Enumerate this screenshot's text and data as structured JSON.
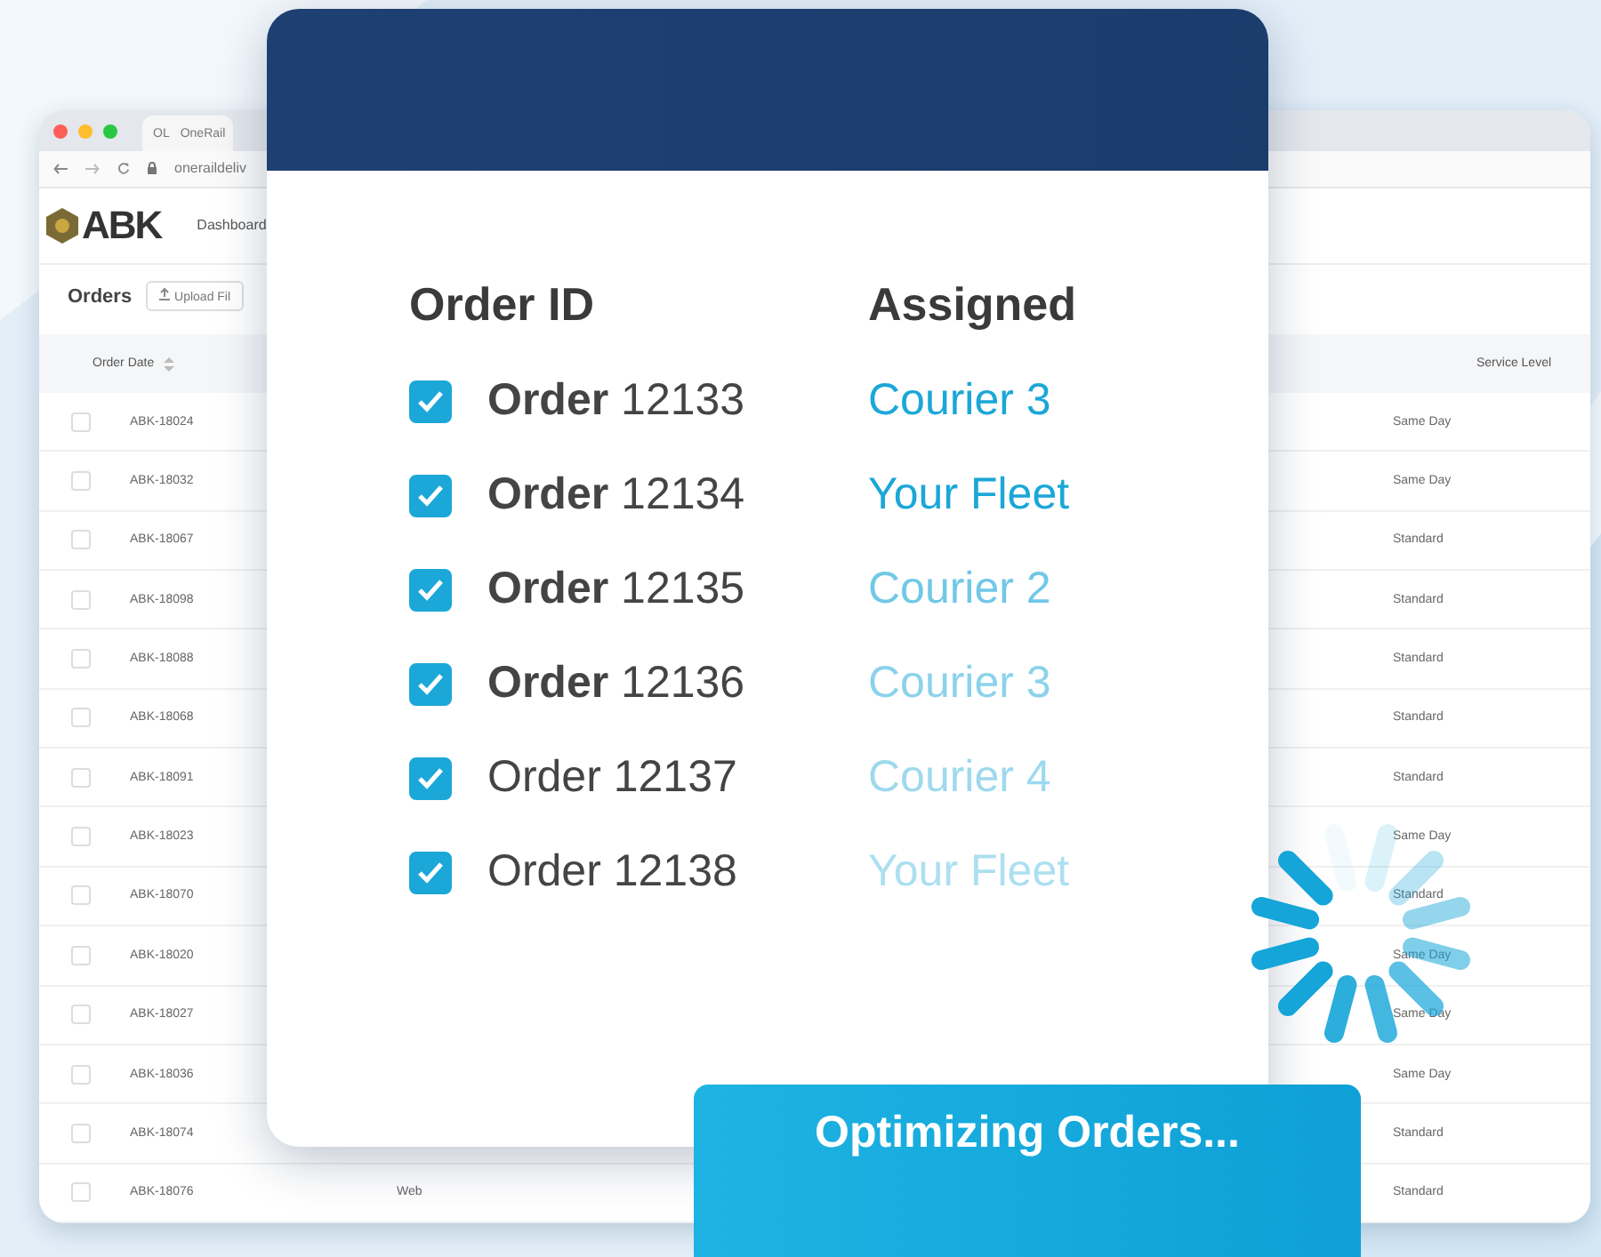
{
  "browser": {
    "tab_title": "OneRail",
    "tab_icon": "OL",
    "url": "oneraildeliv",
    "logo": "ABK",
    "nav": [
      "Dashboard"
    ],
    "page_title": "Orders",
    "upload_button": "Upload Fil",
    "table": {
      "columns": [
        "Order Date",
        "Service Level"
      ],
      "rows": [
        {
          "id": "ABK-18024",
          "service": "Same Day",
          "checked": false
        },
        {
          "id": "ABK-18032",
          "service": "Same Day",
          "checked": false
        },
        {
          "id": "ABK-18067",
          "service": "Standard",
          "checked": false
        },
        {
          "id": "ABK-18098",
          "service": "Standard",
          "checked": false
        },
        {
          "id": "ABK-18088",
          "service": "Standard",
          "checked": false
        },
        {
          "id": "ABK-18068",
          "service": "Standard",
          "checked": false
        },
        {
          "id": "ABK-18091",
          "service": "Standard",
          "checked": false
        },
        {
          "id": "ABK-18023",
          "service": "Same Day",
          "checked": false
        },
        {
          "id": "ABK-18070",
          "service": "Standard",
          "checked": false
        },
        {
          "id": "ABK-18020",
          "service": "Same Day",
          "checked": false
        },
        {
          "id": "ABK-18027",
          "service": "Same Day",
          "checked": false
        },
        {
          "id": "ABK-18036",
          "service": "Same Day",
          "checked": false
        },
        {
          "id": "ABK-18074",
          "service": "Standard",
          "checked": false
        },
        {
          "id": "ABK-18076",
          "source": "Web",
          "service": "Standard",
          "checked": false
        }
      ]
    }
  },
  "card": {
    "columns": [
      "Order ID",
      "Assigned"
    ],
    "rows": [
      {
        "word": "Order",
        "number": "12133",
        "bold": true,
        "checked": true,
        "assigned": "Courier 3",
        "faded": false
      },
      {
        "word": "Order",
        "number": "12134",
        "bold": true,
        "checked": true,
        "assigned": "Your Fleet",
        "faded": false
      },
      {
        "word": "Order",
        "number": "12135",
        "bold": true,
        "checked": true,
        "assigned": "Courier 2",
        "faded": true
      },
      {
        "word": "Order",
        "number": "12136",
        "bold": true,
        "checked": true,
        "assigned": "Courier 3",
        "faded": true
      },
      {
        "word": "Order",
        "number": "12137",
        "bold": false,
        "checked": true,
        "assigned": "Courier 4",
        "faded": true
      },
      {
        "word": "Order",
        "number": "12138",
        "bold": false,
        "checked": true,
        "assigned": "Your Fleet",
        "faded": true
      }
    ]
  },
  "status_button": "Optimizing Orders..."
}
